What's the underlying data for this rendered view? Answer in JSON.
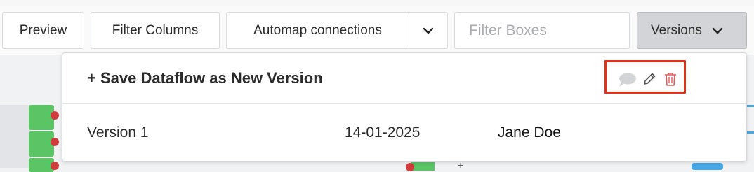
{
  "toolbar": {
    "preview_label": "Preview",
    "filter_columns_label": "Filter Columns",
    "automap_label": "Automap connections",
    "filter_boxes_placeholder": "Filter Boxes",
    "versions_label": "Versions"
  },
  "versions_menu": {
    "save_new_label": "+ Save Dataflow as New Version",
    "versions": [
      {
        "name": "Version 1",
        "date": "14-01-2025",
        "author": "Jane Doe"
      }
    ]
  },
  "icons": {
    "automap_caret": "chevron-down-icon",
    "versions_caret": "chevron-down-icon",
    "comment": "comment-icon",
    "edit": "pencil-icon",
    "delete": "trash-icon"
  },
  "colors": {
    "delete_icon": "#e05c5c",
    "highlight_border": "#e0321b",
    "node_green": "#5bc465"
  }
}
